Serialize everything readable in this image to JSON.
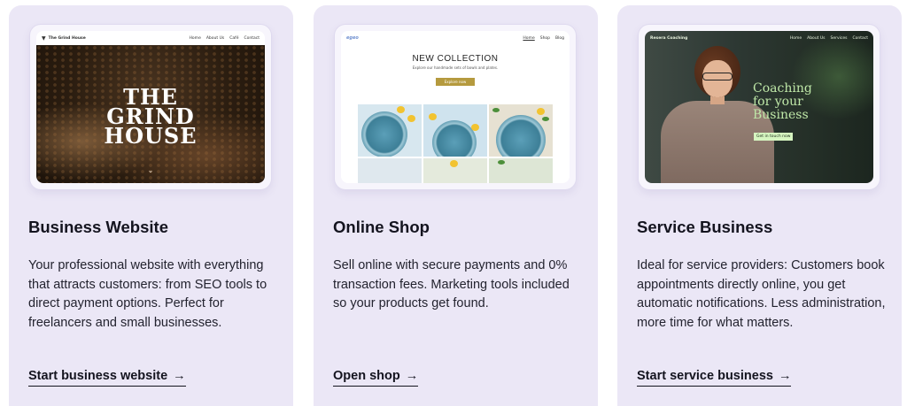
{
  "cards": [
    {
      "title": "Business Website",
      "description": "Your professional website with everything that attracts customers: from SEO tools to direct payment options. Perfect for freelancers and small businesses.",
      "link": "Start business website",
      "arrow": "→",
      "preview": {
        "brand": "The Grind House",
        "nav": [
          "Home",
          "About Us",
          "Café",
          "Contact"
        ],
        "hero_lines": [
          "THE",
          "GRIND",
          "HOUSE"
        ],
        "scroll_glyph": "⌄"
      }
    },
    {
      "title": "Online Shop",
      "description": "Sell online with secure payments and 0% transaction fees. Marketing tools included so your products get found.",
      "link": "Open shop",
      "arrow": "→",
      "preview": {
        "brand": "egeo",
        "nav": [
          "Home",
          "Shop",
          "Blog"
        ],
        "heading": "NEW COLLECTION",
        "subheading": "Explore our handmade sets of bowls and plates.",
        "button": "Explore now"
      }
    },
    {
      "title": "Service Business",
      "description": "Ideal for service providers: Customers book appointments directly online, you get automatic notifications. Less administration, more time for what matters.",
      "link": "Start service business",
      "arrow": "→",
      "preview": {
        "brand": "Resera Coaching",
        "nav": [
          "Home",
          "About Us",
          "Services",
          "Contact"
        ],
        "hero_lines": [
          "Coaching",
          "for your",
          "Business"
        ],
        "button": "Get in touch now"
      }
    }
  ]
}
